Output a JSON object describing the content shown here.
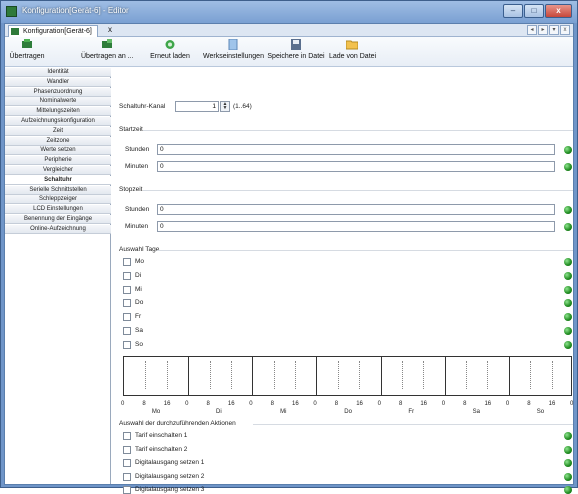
{
  "window": {
    "title": "Konfiguration[Gerät-6] - Editor",
    "min": "–",
    "max": "□",
    "close": "x"
  },
  "doc_tab": {
    "label": "Konfiguration[Gerät-6]",
    "close": "x"
  },
  "toolbar": {
    "items": [
      {
        "label": "Übertragen",
        "icon": "transfer-icon"
      },
      {
        "label": "Übertragen an ...",
        "icon": "transfer-to-icon"
      },
      {
        "label": "Erneut laden",
        "icon": "reload-icon"
      },
      {
        "label": "Werkseinstellungen",
        "icon": "factory-settings-icon"
      },
      {
        "label": "Speichere in Datei",
        "icon": "save-icon"
      },
      {
        "label": "Lade von Datei",
        "icon": "open-folder-icon"
      }
    ]
  },
  "sidebar": {
    "items": [
      "Identität",
      "Wandler",
      "Phasenzuordnung",
      "Nominalwerte",
      "Mittelungszeiten",
      "Aufzeichnungskonfiguration",
      "Zeit",
      "Zeitzone",
      "Werte setzen",
      "Peripherie",
      "Vergleicher",
      "Schaltuhr",
      "Serielle Schnittstellen",
      "Schleppzeiger",
      "LCD Einstellungen",
      "Benennung der Eingänge",
      "Online-Aufzeichnung"
    ],
    "active_index": 11
  },
  "form": {
    "kanal_label": "Schaltuhr-Kanal",
    "kanal_value": "1",
    "kanal_range": "(1..64)",
    "startzeit": "Startzeit",
    "stopzeit": "Stopzeit",
    "stunden": "Stunden",
    "minuten": "Minuten",
    "start_stunden": "0",
    "start_minuten": "0",
    "stop_stunden": "0",
    "stop_minuten": "0",
    "auswahl_tage": "Auswahl Tage",
    "days": [
      "Mo",
      "Di",
      "Mi",
      "Do",
      "Fr",
      "Sa",
      "So"
    ],
    "axis_numbers": [
      "0",
      "8",
      "16"
    ],
    "aktionen_title": "Auswahl der durchzuführenden Aktionen",
    "actions": [
      "Tarif einschalten 1",
      "Tarif einschalten 2",
      "Digitalausgang setzen 1",
      "Digitalausgang setzen 2",
      "Digitalausgang setzen 3"
    ]
  },
  "colors": {
    "status_ok": "#1f8b1f",
    "titlebar": "#7aa0d2"
  }
}
